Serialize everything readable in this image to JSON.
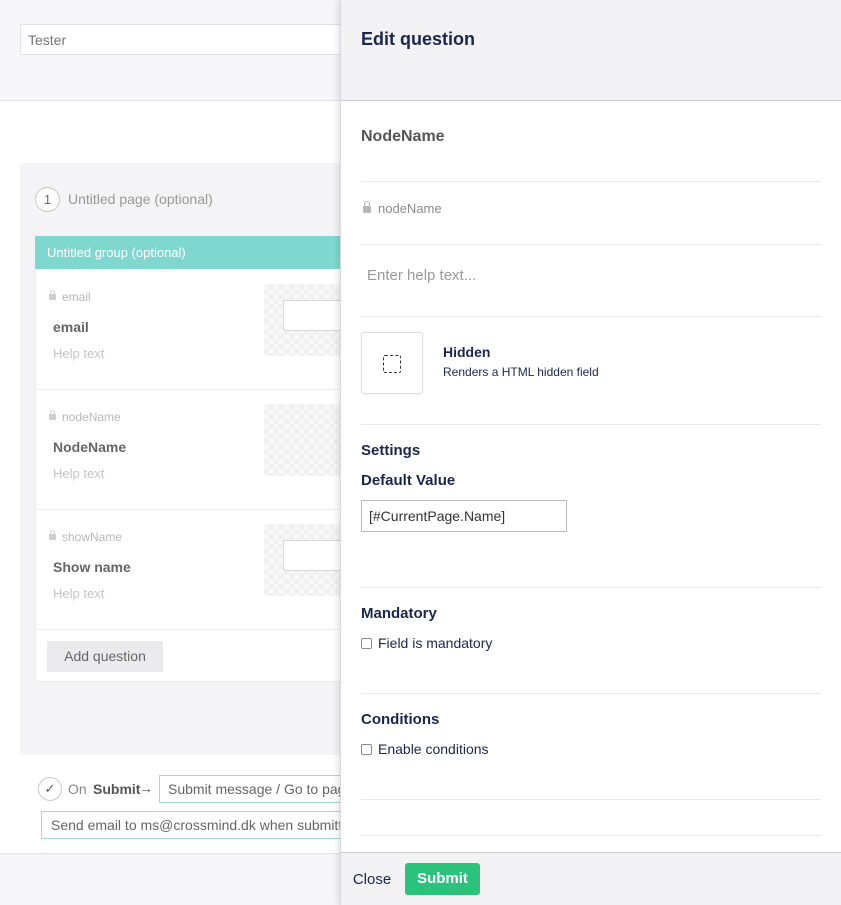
{
  "background": {
    "form_name": "Tester",
    "page": {
      "number": "1",
      "title": "Untitled page (optional)"
    },
    "group": {
      "title": "Untitled group (optional)"
    },
    "questions": [
      {
        "alias": "email",
        "label": "email",
        "help": "Help text"
      },
      {
        "alias": "nodeName",
        "label": "NodeName",
        "help": "Help text"
      },
      {
        "alias": "showName",
        "label": "Show name",
        "help": "Help text"
      }
    ],
    "add_question_label": "Add question",
    "submit_row": {
      "on_label": "On",
      "submit_word": "Submit",
      "arrow": "→",
      "message_text": "Submit message / Go to pag",
      "email_text": "Send email to ms@crossmind.dk when submitte"
    }
  },
  "panel": {
    "title": "Edit question",
    "question_name": "NodeName",
    "alias": "nodeName",
    "help_placeholder": "Enter help text...",
    "field_type": {
      "name": "Hidden",
      "description": "Renders a HTML hidden field"
    },
    "settings_heading": "Settings",
    "default_value_label": "Default Value",
    "default_value": "[#CurrentPage.Name]",
    "mandatory": {
      "heading": "Mandatory",
      "checkbox_label": "Field is mandatory",
      "checked": false
    },
    "conditions": {
      "heading": "Conditions",
      "checkbox_label": "Enable conditions",
      "checked": false
    },
    "close_label": "Close",
    "submit_label": "Submit",
    "colors": {
      "submit": "#2bc37c",
      "group_header": "#7fd8cf",
      "title": "#1b264f"
    }
  }
}
